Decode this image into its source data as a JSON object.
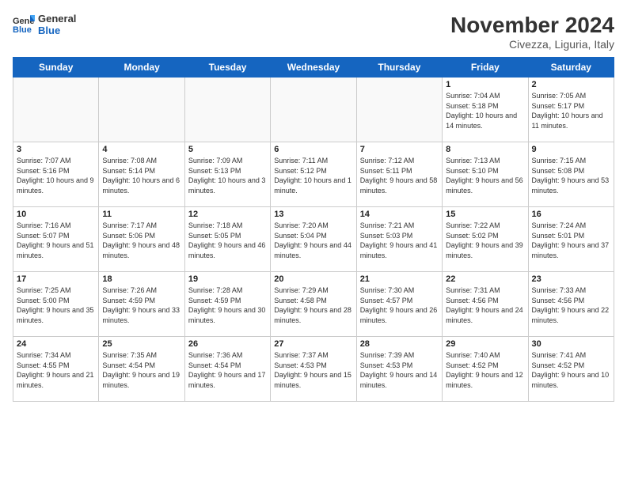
{
  "logo": {
    "general": "General",
    "blue": "Blue"
  },
  "header": {
    "month": "November 2024",
    "location": "Civezza, Liguria, Italy"
  },
  "weekdays": [
    "Sunday",
    "Monday",
    "Tuesday",
    "Wednesday",
    "Thursday",
    "Friday",
    "Saturday"
  ],
  "weeks": [
    [
      {
        "day": "",
        "info": ""
      },
      {
        "day": "",
        "info": ""
      },
      {
        "day": "",
        "info": ""
      },
      {
        "day": "",
        "info": ""
      },
      {
        "day": "",
        "info": ""
      },
      {
        "day": "1",
        "info": "Sunrise: 7:04 AM\nSunset: 5:18 PM\nDaylight: 10 hours and 14 minutes."
      },
      {
        "day": "2",
        "info": "Sunrise: 7:05 AM\nSunset: 5:17 PM\nDaylight: 10 hours and 11 minutes."
      }
    ],
    [
      {
        "day": "3",
        "info": "Sunrise: 7:07 AM\nSunset: 5:16 PM\nDaylight: 10 hours and 9 minutes."
      },
      {
        "day": "4",
        "info": "Sunrise: 7:08 AM\nSunset: 5:14 PM\nDaylight: 10 hours and 6 minutes."
      },
      {
        "day": "5",
        "info": "Sunrise: 7:09 AM\nSunset: 5:13 PM\nDaylight: 10 hours and 3 minutes."
      },
      {
        "day": "6",
        "info": "Sunrise: 7:11 AM\nSunset: 5:12 PM\nDaylight: 10 hours and 1 minute."
      },
      {
        "day": "7",
        "info": "Sunrise: 7:12 AM\nSunset: 5:11 PM\nDaylight: 9 hours and 58 minutes."
      },
      {
        "day": "8",
        "info": "Sunrise: 7:13 AM\nSunset: 5:10 PM\nDaylight: 9 hours and 56 minutes."
      },
      {
        "day": "9",
        "info": "Sunrise: 7:15 AM\nSunset: 5:08 PM\nDaylight: 9 hours and 53 minutes."
      }
    ],
    [
      {
        "day": "10",
        "info": "Sunrise: 7:16 AM\nSunset: 5:07 PM\nDaylight: 9 hours and 51 minutes."
      },
      {
        "day": "11",
        "info": "Sunrise: 7:17 AM\nSunset: 5:06 PM\nDaylight: 9 hours and 48 minutes."
      },
      {
        "day": "12",
        "info": "Sunrise: 7:18 AM\nSunset: 5:05 PM\nDaylight: 9 hours and 46 minutes."
      },
      {
        "day": "13",
        "info": "Sunrise: 7:20 AM\nSunset: 5:04 PM\nDaylight: 9 hours and 44 minutes."
      },
      {
        "day": "14",
        "info": "Sunrise: 7:21 AM\nSunset: 5:03 PM\nDaylight: 9 hours and 41 minutes."
      },
      {
        "day": "15",
        "info": "Sunrise: 7:22 AM\nSunset: 5:02 PM\nDaylight: 9 hours and 39 minutes."
      },
      {
        "day": "16",
        "info": "Sunrise: 7:24 AM\nSunset: 5:01 PM\nDaylight: 9 hours and 37 minutes."
      }
    ],
    [
      {
        "day": "17",
        "info": "Sunrise: 7:25 AM\nSunset: 5:00 PM\nDaylight: 9 hours and 35 minutes."
      },
      {
        "day": "18",
        "info": "Sunrise: 7:26 AM\nSunset: 4:59 PM\nDaylight: 9 hours and 33 minutes."
      },
      {
        "day": "19",
        "info": "Sunrise: 7:28 AM\nSunset: 4:59 PM\nDaylight: 9 hours and 30 minutes."
      },
      {
        "day": "20",
        "info": "Sunrise: 7:29 AM\nSunset: 4:58 PM\nDaylight: 9 hours and 28 minutes."
      },
      {
        "day": "21",
        "info": "Sunrise: 7:30 AM\nSunset: 4:57 PM\nDaylight: 9 hours and 26 minutes."
      },
      {
        "day": "22",
        "info": "Sunrise: 7:31 AM\nSunset: 4:56 PM\nDaylight: 9 hours and 24 minutes."
      },
      {
        "day": "23",
        "info": "Sunrise: 7:33 AM\nSunset: 4:56 PM\nDaylight: 9 hours and 22 minutes."
      }
    ],
    [
      {
        "day": "24",
        "info": "Sunrise: 7:34 AM\nSunset: 4:55 PM\nDaylight: 9 hours and 21 minutes."
      },
      {
        "day": "25",
        "info": "Sunrise: 7:35 AM\nSunset: 4:54 PM\nDaylight: 9 hours and 19 minutes."
      },
      {
        "day": "26",
        "info": "Sunrise: 7:36 AM\nSunset: 4:54 PM\nDaylight: 9 hours and 17 minutes."
      },
      {
        "day": "27",
        "info": "Sunrise: 7:37 AM\nSunset: 4:53 PM\nDaylight: 9 hours and 15 minutes."
      },
      {
        "day": "28",
        "info": "Sunrise: 7:39 AM\nSunset: 4:53 PM\nDaylight: 9 hours and 14 minutes."
      },
      {
        "day": "29",
        "info": "Sunrise: 7:40 AM\nSunset: 4:52 PM\nDaylight: 9 hours and 12 minutes."
      },
      {
        "day": "30",
        "info": "Sunrise: 7:41 AM\nSunset: 4:52 PM\nDaylight: 9 hours and 10 minutes."
      }
    ]
  ]
}
